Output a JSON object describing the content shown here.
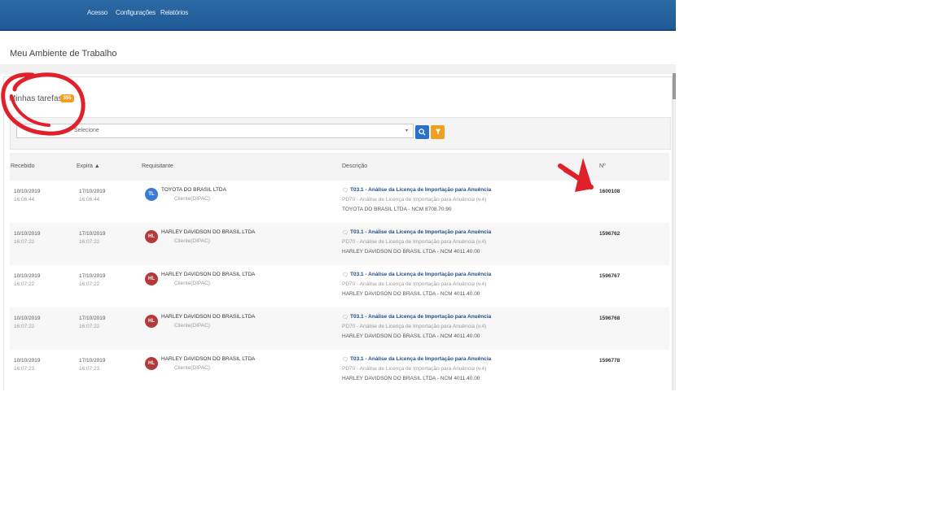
{
  "nav": {
    "items": [
      "Acesso",
      "Configurações",
      "Relatórios"
    ],
    "color": "#1e5a96"
  },
  "page_title": "Meu Ambiente de Trabalho",
  "panel": {
    "heading": "Minhas tarefas",
    "badge": "355"
  },
  "filter": {
    "value": "Selecione",
    "search_icon": "search-icon",
    "filter_icon": "filter-icon"
  },
  "table": {
    "headers": [
      "Recebido",
      "Expira ▲",
      "Requisitante",
      "Descrição",
      "Nº"
    ],
    "rows": [
      {
        "received_date": "10/10/2019",
        "received_time": "16:06:44",
        "expires_date": "17/10/2019",
        "expires_time": "16:06:44",
        "initials": "TL",
        "avatar_color": "blue",
        "requester": "TOYOTA DO BRASIL LTDA",
        "role": "Cliente(DIPAC)",
        "desc_title": "T03.1 - Análise da Licença de Importação para Anuência",
        "desc_sub": "PD70 - Análise de Licença de Importação para Anuência (v.4)",
        "desc_detail": "TOYOTA DO BRASIL LTDA - NCM 8708.70.90",
        "number": "1600108"
      },
      {
        "received_date": "10/10/2019",
        "received_time": "16:07:22",
        "expires_date": "17/10/2019",
        "expires_time": "16:07:22",
        "initials": "HL",
        "avatar_color": "red",
        "requester": "HARLEY DAVIDSON DO BRASIL LTDA",
        "role": "Cliente(DIPAC)",
        "desc_title": "T03.1 - Análise da Licença de Importação para Anuência",
        "desc_sub": "PD70 - Análise de Licença de Importação para Anuência (v.4)",
        "desc_detail": "HARLEY DAVIDSON DO BRASIL LTDA - NCM 4011.40.00",
        "number": "1596762"
      },
      {
        "received_date": "10/10/2019",
        "received_time": "16:07:22",
        "expires_date": "17/10/2019",
        "expires_time": "16:07:22",
        "initials": "HL",
        "avatar_color": "red",
        "requester": "HARLEY DAVIDSON DO BRASIL LTDA",
        "role": "Cliente(DIPAC)",
        "desc_title": "T03.1 - Análise da Licença de Importação para Anuência",
        "desc_sub": "PD70 - Análise de Licença de Importação para Anuência (v.4)",
        "desc_detail": "HARLEY DAVIDSON DO BRASIL LTDA - NCM 4011.40.00",
        "number": "1596767"
      },
      {
        "received_date": "10/10/2019",
        "received_time": "16:07:22",
        "expires_date": "17/10/2019",
        "expires_time": "16:07:22",
        "initials": "HL",
        "avatar_color": "red",
        "requester": "HARLEY DAVIDSON DO BRASIL LTDA",
        "role": "Cliente(DIPAC)",
        "desc_title": "T03.1 - Análise da Licença de Importação para Anuência",
        "desc_sub": "PD70 - Análise de Licença de Importação para Anuência (v.4)",
        "desc_detail": "HARLEY DAVIDSON DO BRASIL LTDA - NCM 4011.40.00",
        "number": "1596768"
      },
      {
        "received_date": "10/10/2019",
        "received_time": "16:07:23",
        "expires_date": "17/10/2019",
        "expires_time": "16:07:23",
        "initials": "HL",
        "avatar_color": "red",
        "requester": "HARLEY DAVIDSON DO BRASIL LTDA",
        "role": "Cliente(DIPAC)",
        "desc_title": "T03.1 - Análise da Licença de Importação para Anuência",
        "desc_sub": "PD70 - Análise de Licença de Importação para Anuência (v.4)",
        "desc_detail": "HARLEY DAVIDSON DO BRASIL LTDA - NCM 4011.40.00",
        "number": "1596778"
      }
    ]
  },
  "annotations": {
    "color": "#e0202a",
    "circle_target": "Minhas tarefas",
    "arrow_target": "Nº"
  }
}
